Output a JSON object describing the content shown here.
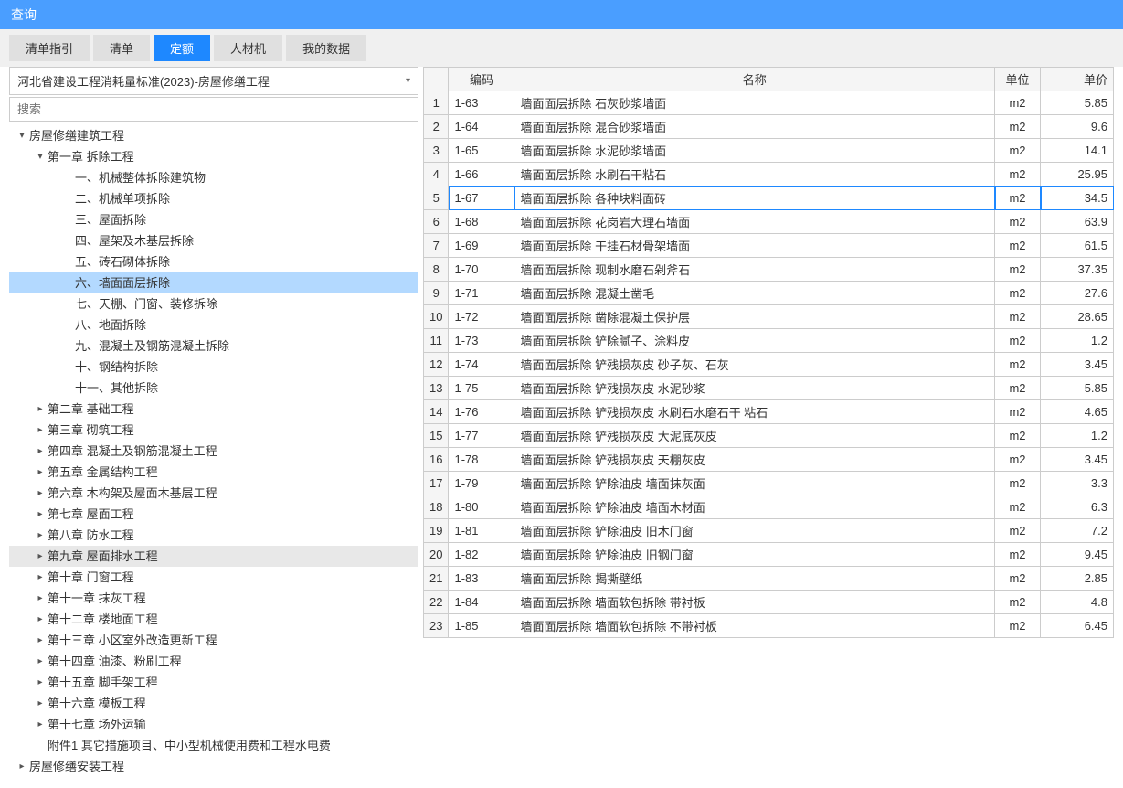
{
  "titlebar": {
    "title": "查询"
  },
  "tabs": [
    {
      "label": "清单指引",
      "active": false
    },
    {
      "label": "清单",
      "active": false
    },
    {
      "label": "定额",
      "active": true
    },
    {
      "label": "人材机",
      "active": false
    },
    {
      "label": "我的数据",
      "active": false
    }
  ],
  "dropdown": {
    "value": "河北省建设工程消耗量标准(2023)-房屋修缮工程"
  },
  "search": {
    "placeholder": "搜索"
  },
  "tree": [
    {
      "level": 0,
      "toggle": "▾",
      "label": "房屋修缮建筑工程"
    },
    {
      "level": 1,
      "toggle": "▾",
      "label": "第一章 拆除工程"
    },
    {
      "level": 2,
      "toggle": "",
      "label": "一、机械整体拆除建筑物"
    },
    {
      "level": 2,
      "toggle": "",
      "label": "二、机械单项拆除"
    },
    {
      "level": 2,
      "toggle": "",
      "label": "三、屋面拆除"
    },
    {
      "level": 2,
      "toggle": "",
      "label": "四、屋架及木基层拆除"
    },
    {
      "level": 2,
      "toggle": "",
      "label": "五、砖石砌体拆除"
    },
    {
      "level": 2,
      "toggle": "",
      "label": "六、墙面面层拆除",
      "selected": true
    },
    {
      "level": 2,
      "toggle": "",
      "label": "七、天棚、门窗、装修拆除"
    },
    {
      "level": 2,
      "toggle": "",
      "label": "八、地面拆除"
    },
    {
      "level": 2,
      "toggle": "",
      "label": "九、混凝土及钢筋混凝土拆除"
    },
    {
      "level": 2,
      "toggle": "",
      "label": "十、钢结构拆除"
    },
    {
      "level": 2,
      "toggle": "",
      "label": "十一、其他拆除"
    },
    {
      "level": 1,
      "toggle": "▸",
      "label": "第二章 基础工程"
    },
    {
      "level": 1,
      "toggle": "▸",
      "label": "第三章 砌筑工程"
    },
    {
      "level": 1,
      "toggle": "▸",
      "label": "第四章 混凝土及钢筋混凝土工程"
    },
    {
      "level": 1,
      "toggle": "▸",
      "label": "第五章 金属结构工程"
    },
    {
      "level": 1,
      "toggle": "▸",
      "label": "第六章 木构架及屋面木基层工程"
    },
    {
      "level": 1,
      "toggle": "▸",
      "label": "第七章 屋面工程"
    },
    {
      "level": 1,
      "toggle": "▸",
      "label": "第八章 防水工程"
    },
    {
      "level": 1,
      "toggle": "▸",
      "label": "第九章 屋面排水工程",
      "highlighted": true
    },
    {
      "level": 1,
      "toggle": "▸",
      "label": "第十章 门窗工程"
    },
    {
      "level": 1,
      "toggle": "▸",
      "label": "第十一章 抹灰工程"
    },
    {
      "level": 1,
      "toggle": "▸",
      "label": "第十二章 楼地面工程"
    },
    {
      "level": 1,
      "toggle": "▸",
      "label": "第十三章 小区室外改造更新工程"
    },
    {
      "level": 1,
      "toggle": "▸",
      "label": "第十四章 油漆、粉刷工程"
    },
    {
      "level": 1,
      "toggle": "▸",
      "label": "第十五章 脚手架工程"
    },
    {
      "level": 1,
      "toggle": "▸",
      "label": "第十六章 模板工程"
    },
    {
      "level": 1,
      "toggle": "▸",
      "label": "第十七章 场外运输"
    },
    {
      "level": 1,
      "toggle": "",
      "label": "附件1 其它措施项目、中小型机械使用费和工程水电费"
    },
    {
      "level": 0,
      "toggle": "▸",
      "label": "房屋修缮安装工程"
    }
  ],
  "table": {
    "headers": {
      "code": "编码",
      "name": "名称",
      "unit": "单位",
      "price": "单价"
    },
    "rows": [
      {
        "n": 1,
        "code": "1-63",
        "name": "墙面面层拆除 石灰砂浆墙面",
        "unit": "m2",
        "price": "5.85"
      },
      {
        "n": 2,
        "code": "1-64",
        "name": "墙面面层拆除 混合砂浆墙面",
        "unit": "m2",
        "price": "9.6"
      },
      {
        "n": 3,
        "code": "1-65",
        "name": "墙面面层拆除 水泥砂浆墙面",
        "unit": "m2",
        "price": "14.1"
      },
      {
        "n": 4,
        "code": "1-66",
        "name": "墙面面层拆除 水刷石干粘石",
        "unit": "m2",
        "price": "25.95"
      },
      {
        "n": 5,
        "code": "1-67",
        "name": "墙面面层拆除 各种块料面砖",
        "unit": "m2",
        "price": "34.5",
        "selected": true
      },
      {
        "n": 6,
        "code": "1-68",
        "name": "墙面面层拆除 花岗岩大理石墙面",
        "unit": "m2",
        "price": "63.9"
      },
      {
        "n": 7,
        "code": "1-69",
        "name": "墙面面层拆除 干挂石材骨架墙面",
        "unit": "m2",
        "price": "61.5"
      },
      {
        "n": 8,
        "code": "1-70",
        "name": "墙面面层拆除 现制水磨石剁斧石",
        "unit": "m2",
        "price": "37.35"
      },
      {
        "n": 9,
        "code": "1-71",
        "name": "墙面面层拆除 混凝土凿毛",
        "unit": "m2",
        "price": "27.6"
      },
      {
        "n": 10,
        "code": "1-72",
        "name": "墙面面层拆除 凿除混凝土保护层",
        "unit": "m2",
        "price": "28.65"
      },
      {
        "n": 11,
        "code": "1-73",
        "name": "墙面面层拆除 铲除腻子、涂料皮",
        "unit": "m2",
        "price": "1.2"
      },
      {
        "n": 12,
        "code": "1-74",
        "name": "墙面面层拆除 铲残损灰皮 砂子灰、石灰",
        "unit": "m2",
        "price": "3.45"
      },
      {
        "n": 13,
        "code": "1-75",
        "name": "墙面面层拆除 铲残损灰皮 水泥砂浆",
        "unit": "m2",
        "price": "5.85"
      },
      {
        "n": 14,
        "code": "1-76",
        "name": "墙面面层拆除 铲残损灰皮 水刷石水磨石干 粘石",
        "unit": "m2",
        "price": "4.65"
      },
      {
        "n": 15,
        "code": "1-77",
        "name": "墙面面层拆除 铲残损灰皮 大泥底灰皮",
        "unit": "m2",
        "price": "1.2"
      },
      {
        "n": 16,
        "code": "1-78",
        "name": "墙面面层拆除 铲残损灰皮 天棚灰皮",
        "unit": "m2",
        "price": "3.45"
      },
      {
        "n": 17,
        "code": "1-79",
        "name": "墙面面层拆除 铲除油皮 墙面抹灰面",
        "unit": "m2",
        "price": "3.3"
      },
      {
        "n": 18,
        "code": "1-80",
        "name": "墙面面层拆除 铲除油皮 墙面木材面",
        "unit": "m2",
        "price": "6.3"
      },
      {
        "n": 19,
        "code": "1-81",
        "name": "墙面面层拆除 铲除油皮 旧木门窗",
        "unit": "m2",
        "price": "7.2"
      },
      {
        "n": 20,
        "code": "1-82",
        "name": "墙面面层拆除 铲除油皮 旧钢门窗",
        "unit": "m2",
        "price": "9.45"
      },
      {
        "n": 21,
        "code": "1-83",
        "name": "墙面面层拆除 揭撕壁纸",
        "unit": "m2",
        "price": "2.85"
      },
      {
        "n": 22,
        "code": "1-84",
        "name": "墙面面层拆除 墙面软包拆除 带衬板",
        "unit": "m2",
        "price": "4.8"
      },
      {
        "n": 23,
        "code": "1-85",
        "name": "墙面面层拆除 墙面软包拆除 不带衬板",
        "unit": "m2",
        "price": "6.45"
      }
    ]
  }
}
